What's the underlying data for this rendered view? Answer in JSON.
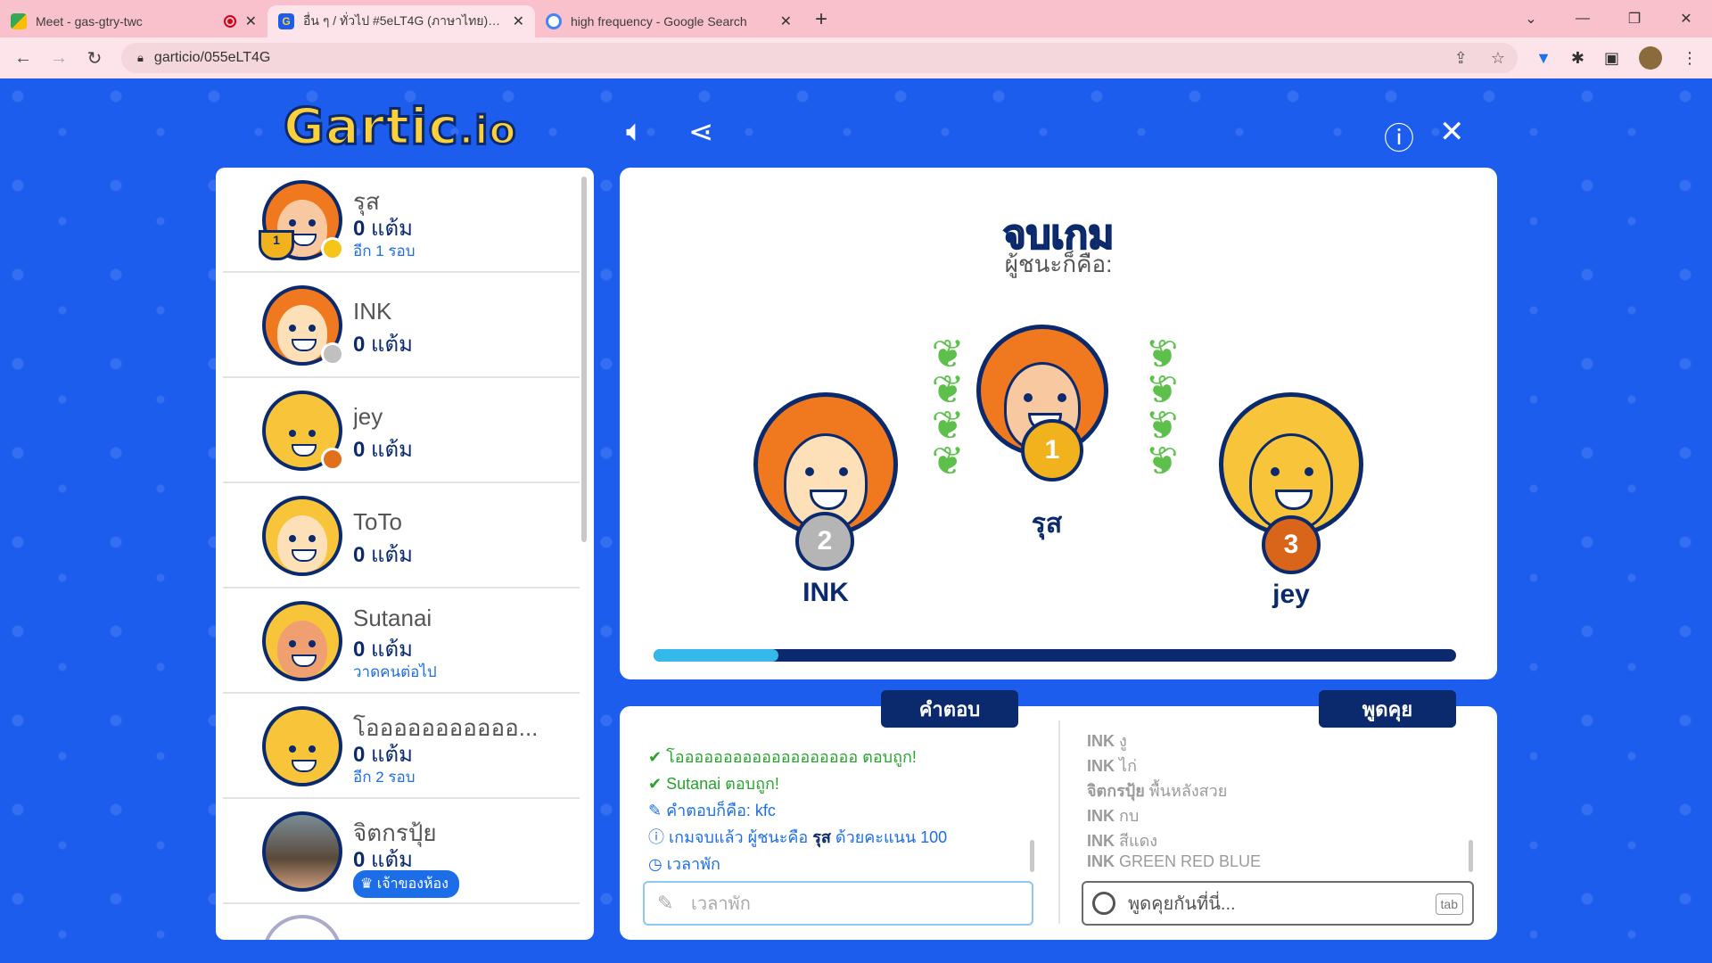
{
  "browser": {
    "tabs": [
      {
        "title": "Meet - gas-gtry-twc",
        "favicon_color": "#1a73e8"
      },
      {
        "title": "อื่น ๆ / ทั่วไป #5eLT4G (ภาษาไทย) - Gartic",
        "favicon_color": "#1c5ded"
      },
      {
        "title": "high frequency - Google Search",
        "favicon_color": "#4285f4"
      }
    ],
    "new_tab": "+",
    "url": "garticio/055eLT4G",
    "controls": {
      "minimize": "—",
      "restore": "❐",
      "close": "✕",
      "menu": "⌄"
    }
  },
  "app": {
    "logo_text": "Gartic",
    "logo_suffix": ".io",
    "players": [
      {
        "name": "รุส",
        "score": "0",
        "score_unit": "แต้ม",
        "status": "อีก 1 รอบ",
        "status_color": "#f5c518",
        "is_winner": true
      },
      {
        "name": "INK",
        "score": "0",
        "score_unit": "แต้ม",
        "status": "",
        "status_color": "#c0c0c0"
      },
      {
        "name": "jey",
        "score": "0",
        "score_unit": "แต้ม",
        "status": "",
        "status_color": "#e0701a"
      },
      {
        "name": "ToTo",
        "score": "0",
        "score_unit": "แต้ม",
        "status": ""
      },
      {
        "name": "Sutanai",
        "score": "0",
        "score_unit": "แต้ม",
        "status": "วาดคนต่อไป"
      },
      {
        "name": "โอออออออออออ...",
        "score": "0",
        "score_unit": "แต้ม",
        "status": "อีก 2 รอบ"
      },
      {
        "name": "จิตกรปุ้ย",
        "score": "0",
        "score_unit": "แต้ม",
        "badge": "เจ้าของห้อง"
      }
    ],
    "trophy_rank": "1",
    "results": {
      "title": "จบเกม",
      "subtitle": "ผู้ชนะก็คือ:",
      "first": {
        "name": "รุส",
        "rank": "1"
      },
      "second": {
        "name": "INK",
        "rank": "2"
      },
      "third": {
        "name": "jey",
        "rank": "3"
      },
      "progress_fraction": 0.155
    },
    "answers": {
      "header": "คำตอบ",
      "messages": [
        {
          "icon": "✔",
          "text": "โอออออออออออออออออออ ตอบถูก!",
          "type": "ok"
        },
        {
          "icon": "✔",
          "text": "Sutanai ตอบถูก!",
          "type": "ok"
        },
        {
          "icon": "✎",
          "text": "คำตอบก็คือ: kfc",
          "type": "info"
        },
        {
          "icon": "ⓘ",
          "text_pre": "เกมจบแล้ว ผู้ชนะคือ ",
          "text_bold": "รุส",
          "text_post": " ด้วยคะแนน 100",
          "type": "info"
        },
        {
          "icon": "◷",
          "text": "เวลาพัก",
          "type": "info"
        }
      ],
      "input_placeholder": "เวลาพัก"
    },
    "chat": {
      "header": "พูดคุย",
      "messages": [
        {
          "user": "INK",
          "text": "งู"
        },
        {
          "user": "INK",
          "text": "ไก่"
        },
        {
          "user": "จิตกรปุ้ย",
          "text": "พื้นหลังสวย"
        },
        {
          "user": "INK",
          "text": "กบ"
        },
        {
          "user": "INK",
          "text": "สีแดง"
        },
        {
          "user": "INK",
          "text": "GREEN RED BLUE"
        }
      ],
      "input_placeholder": "พูดคุยกันที่นี่...",
      "tab_hint": "tab"
    }
  }
}
